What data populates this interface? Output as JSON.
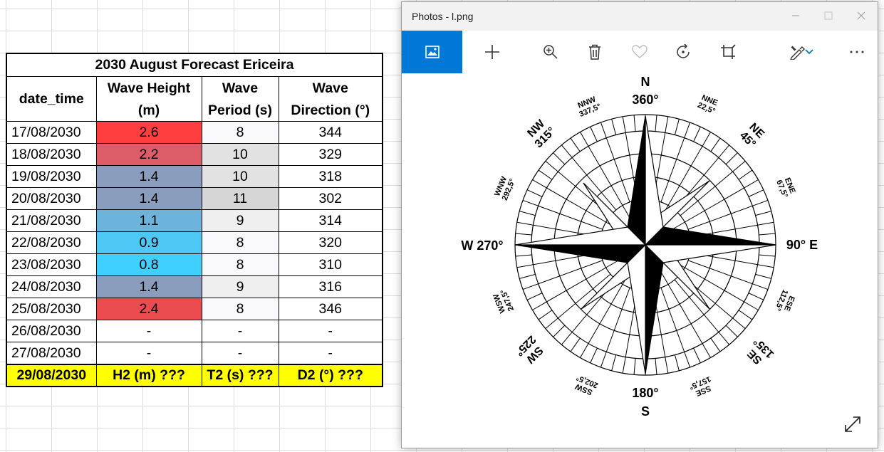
{
  "sheet": {
    "title": "2030 August Forecast Ericeira",
    "headers": {
      "date": "date_time",
      "height_1": "Wave Height",
      "height_2": "(m)",
      "period_1": "Wave",
      "period_2": "Period (s)",
      "dir_1": "Wave",
      "dir_2": "Direction (°)"
    },
    "rows": [
      {
        "date": "17/08/2030",
        "height": "2.6",
        "period": "8",
        "direction": "344",
        "height_color": "#ff3f3f",
        "period_color": "#f9f9fb"
      },
      {
        "date": "18/08/2030",
        "height": "2.2",
        "period": "10",
        "direction": "329",
        "height_color": "#dc5d68",
        "period_color": "#e2e2e3"
      },
      {
        "date": "19/08/2030",
        "height": "1.4",
        "period": "10",
        "direction": "318",
        "height_color": "#8b9dbc",
        "period_color": "#e2e2e3"
      },
      {
        "date": "20/08/2030",
        "height": "1.4",
        "period": "11",
        "direction": "302",
        "height_color": "#8b9dbc",
        "period_color": "#d6d6d6"
      },
      {
        "date": "21/08/2030",
        "height": "1.1",
        "period": "9",
        "direction": "314",
        "height_color": "#6db4dc",
        "period_color": "#efeff0"
      },
      {
        "date": "22/08/2030",
        "height": "0.9",
        "period": "8",
        "direction": "320",
        "height_color": "#4fc7f4",
        "period_color": "#f9f9fb"
      },
      {
        "date": "23/08/2030",
        "height": "0.8",
        "period": "8",
        "direction": "310",
        "height_color": "#3fd0ff",
        "period_color": "#f9f9fb"
      },
      {
        "date": "24/08/2030",
        "height": "1.4",
        "period": "9",
        "direction": "316",
        "height_color": "#8b9dbc",
        "period_color": "#efeff0"
      },
      {
        "date": "25/08/2030",
        "height": "2.4",
        "period": "8",
        "direction": "346",
        "height_color": "#ea4b4f",
        "period_color": "#f9f9fb"
      },
      {
        "date": "26/08/2030",
        "height": "-",
        "period": "-",
        "direction": "-",
        "height_color": "#ffffff",
        "period_color": "#ffffff"
      },
      {
        "date": "27/08/2030",
        "height": "-",
        "period": "-",
        "direction": "-",
        "height_color": "#ffffff",
        "period_color": "#ffffff"
      }
    ],
    "final_row": {
      "date": "29/08/2030",
      "height": "H2 (m) ???",
      "period": "T2 (s) ???",
      "direction": "D2 (°) ???",
      "color": "#ffff00"
    }
  },
  "photos": {
    "window_title": "Photos - l.png",
    "accent": "#0078d7",
    "toolbar": [
      "image-view-icon",
      "add-icon",
      "zoom-in-icon",
      "delete-icon",
      "favorite-icon",
      "rotate-icon",
      "crop-icon",
      "edit-draw-icon",
      "chevron-down-icon",
      "more-icon"
    ],
    "compass": {
      "N": "N",
      "N_deg": "360°",
      "S": "S",
      "S_deg": "180°",
      "E": "90° E",
      "W": "W 270°",
      "NE": "NE",
      "NE_deg": "45°",
      "NW": "NW",
      "NW_deg": "315°",
      "SE": "SE",
      "SE_deg": "135°",
      "SW": "SW",
      "SW_deg": "225°",
      "NNE": "NNE",
      "NNE_deg": "22,5°",
      "NNW": "NNW",
      "NNW_deg": "337,5°",
      "ENE": "ENE",
      "ENE_deg": "67,5°",
      "ESE": "ESE",
      "ESE_deg": "112,5°",
      "SSE": "SSE",
      "SSE_deg": "157,5°",
      "SSW": "SSW",
      "SSW_deg": "202,5°",
      "WSW": "WSW",
      "WSW_deg": "247,5°",
      "WNW": "WNW",
      "WNW_deg": "292,5°"
    }
  }
}
